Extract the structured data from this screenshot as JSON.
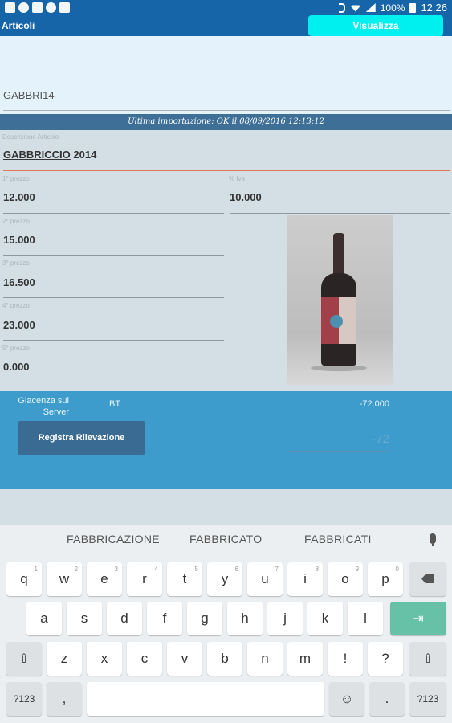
{
  "status_bar": {
    "battery": "100%",
    "time": "12:26"
  },
  "header": {
    "title": "Articoli",
    "view_button": "Visualizza"
  },
  "article": {
    "code": "GABBRI14",
    "import_status": "Ultima importazione: OK il 08/09/2016 12:13:12",
    "description_label": "Descrizione Articolo",
    "description_word1": "GABBRICCIO",
    "description_word2": " 2014",
    "prices": [
      {
        "label": "1° prezzo",
        "value": "12.000"
      },
      {
        "label": "2° prezzo",
        "value": "15.000"
      },
      {
        "label": "3° prezzo",
        "value": "16.500"
      },
      {
        "label": "4° prezzo",
        "value": "23.000"
      },
      {
        "label": "5° prezzo",
        "value": "0.000"
      }
    ],
    "vat_label": "% Iva",
    "vat_value": "10.000",
    "image_alt": "wine-bottle-photo"
  },
  "giacenza": {
    "label": "Giacenza sul Server",
    "unit": "BT",
    "quantity": "-72.000",
    "register_button": "Registra Rilevazione",
    "input_value": "-72"
  },
  "keyboard": {
    "suggestions": [
      "FABBRICAZIONE",
      "FABBRICATO",
      "FABBRICATI"
    ],
    "row1": [
      {
        "key": "q",
        "hint": "1"
      },
      {
        "key": "w",
        "hint": "2"
      },
      {
        "key": "e",
        "hint": "3"
      },
      {
        "key": "r",
        "hint": "4"
      },
      {
        "key": "t",
        "hint": "5"
      },
      {
        "key": "y",
        "hint": "6"
      },
      {
        "key": "u",
        "hint": "7"
      },
      {
        "key": "i",
        "hint": "8"
      },
      {
        "key": "o",
        "hint": "9"
      },
      {
        "key": "p",
        "hint": "0"
      }
    ],
    "row2": [
      "a",
      "s",
      "d",
      "f",
      "g",
      "h",
      "j",
      "k",
      "l"
    ],
    "row3": [
      "z",
      "x",
      "c",
      "v",
      "b",
      "n",
      "m",
      "!",
      "?"
    ],
    "symbols_key": "?123",
    "comma_key": ",",
    "period_key": "."
  }
}
